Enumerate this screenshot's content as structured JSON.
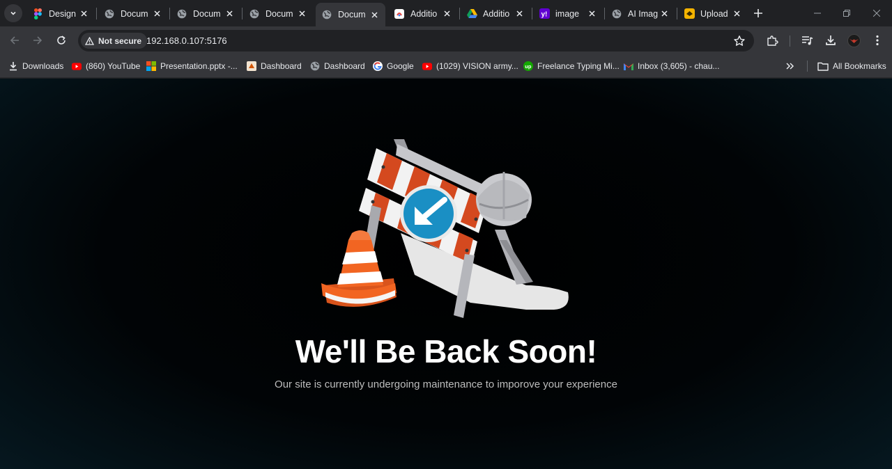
{
  "tabs": [
    {
      "title": "Design",
      "icon": "figma-icon"
    },
    {
      "title": "Docum",
      "icon": "globe-icon"
    },
    {
      "title": "Docum",
      "icon": "globe-icon"
    },
    {
      "title": "Docum",
      "icon": "globe-icon"
    },
    {
      "title": "Docum",
      "icon": "globe-icon",
      "active": true
    },
    {
      "title": "Additio",
      "icon": "app-icon"
    },
    {
      "title": "Additio",
      "icon": "drive-icon"
    },
    {
      "title": "image",
      "icon": "yahoo-icon"
    },
    {
      "title": "AI Imag",
      "icon": "globe-icon"
    },
    {
      "title": "Upload",
      "icon": "upload-app-icon"
    }
  ],
  "toolbar": {
    "security_label": "Not secure",
    "url": "192.168.0.107:5176"
  },
  "bookmarks": [
    {
      "label": "Downloads",
      "icon": "download-icon"
    },
    {
      "label": "(860) YouTube",
      "icon": "youtube-icon"
    },
    {
      "label": "Presentation.pptx -...",
      "icon": "microsoft-icon"
    },
    {
      "label": "Dashboard",
      "icon": "dashboard-app-icon"
    },
    {
      "label": "Dashboard",
      "icon": "globe-icon"
    },
    {
      "label": "Google",
      "icon": "google-icon"
    },
    {
      "label": "(1029) VISION army...",
      "icon": "youtube-icon"
    },
    {
      "label": "Freelance Typing Mi...",
      "icon": "upwork-icon"
    },
    {
      "label": "Inbox (3,605) - chau...",
      "icon": "gmail-icon"
    }
  ],
  "all_bookmarks_label": "All Bookmarks",
  "page": {
    "headline": "We'll Be Back Soon!",
    "subtext": "Our site is currently undergoing maintenance to imporove your experience"
  },
  "colors": {
    "page_background": "#000000",
    "cone_orange": "#f26522",
    "sign_blue": "#1a8fc4",
    "stripe_red": "#d4491f"
  }
}
